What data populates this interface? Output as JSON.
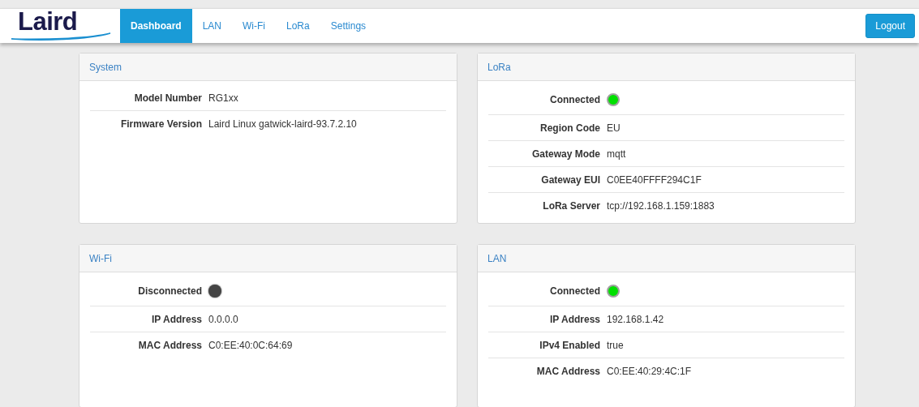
{
  "brand": {
    "logo_text": "Laird"
  },
  "nav": {
    "tabs": [
      {
        "label": "Dashboard",
        "selected": true
      },
      {
        "label": "LAN",
        "selected": false
      },
      {
        "label": "Wi-Fi",
        "selected": false
      },
      {
        "label": "LoRa",
        "selected": false
      },
      {
        "label": "Settings",
        "selected": false
      }
    ],
    "logout_button": "Logout"
  },
  "panels": [
    {
      "title": "System",
      "rows": [
        {
          "kind": "field",
          "label": "Model Number",
          "value": "RG1xx"
        },
        {
          "kind": "field",
          "label": "Firmware Version",
          "value": "Laird Linux gatwick-laird-93.7.2.10"
        }
      ]
    },
    {
      "title": "LoRa",
      "rows": [
        {
          "kind": "status",
          "label": "Connected",
          "connected": true
        },
        {
          "kind": "field",
          "label": "Region Code",
          "value": "EU"
        },
        {
          "kind": "field",
          "label": "Gateway Mode",
          "value": "mqtt"
        },
        {
          "kind": "field",
          "label": "Gateway EUI",
          "value": "C0EE40FFFF294C1F"
        },
        {
          "kind": "field",
          "label": "LoRa Server",
          "value": "tcp://192.168.1.159:1883"
        }
      ]
    },
    {
      "title": "Wi-Fi",
      "rows": [
        {
          "kind": "status",
          "label": "Disconnected",
          "connected": false
        },
        {
          "kind": "field",
          "label": "IP Address",
          "value": "0.0.0.0"
        },
        {
          "kind": "field",
          "label": "MAC Address",
          "value": "C0:EE:40:0C:64:69"
        }
      ]
    },
    {
      "title": "LAN",
      "rows": [
        {
          "kind": "status",
          "label": "Connected",
          "connected": true
        },
        {
          "kind": "field",
          "label": "IP Address",
          "value": "192.168.1.42"
        },
        {
          "kind": "field",
          "label": "IPv4 Enabled",
          "value": "true"
        },
        {
          "kind": "field",
          "label": "MAC Address",
          "value": "C0:EE:40:29:4C:1F"
        }
      ]
    }
  ]
}
